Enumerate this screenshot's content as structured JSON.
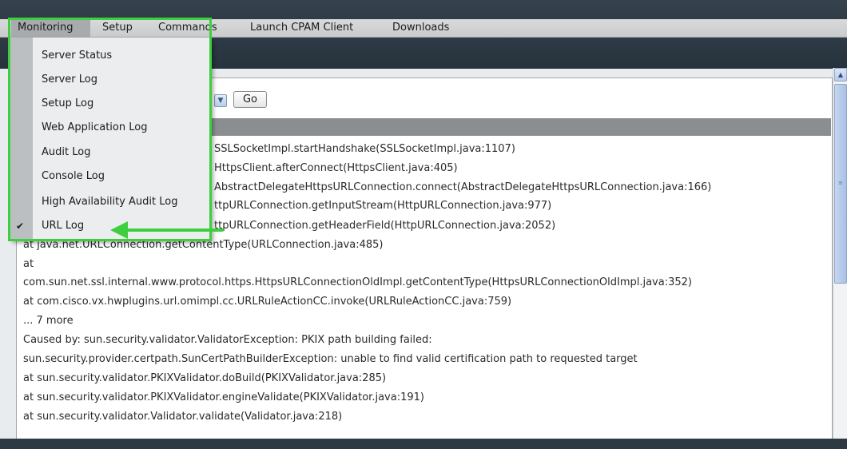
{
  "menubar": {
    "items": [
      {
        "label": "Monitoring"
      },
      {
        "label": "Setup"
      },
      {
        "label": "Commands"
      },
      {
        "label": "Launch CPAM Client"
      },
      {
        "label": "Downloads"
      }
    ]
  },
  "toolbar": {
    "go_label": "Go"
  },
  "monitoring_menu": {
    "items": [
      {
        "label": "Server Status",
        "checked": false
      },
      {
        "label": "Server Log",
        "checked": false
      },
      {
        "label": "Setup Log",
        "checked": false
      },
      {
        "label": "Web Application Log",
        "checked": false
      },
      {
        "label": "Audit Log",
        "checked": false
      },
      {
        "label": "Console Log",
        "checked": false
      },
      {
        "label": "High Availability Audit Log",
        "checked": false
      },
      {
        "label": "URL Log",
        "checked": true
      }
    ],
    "check_glyph": "✔"
  },
  "log": {
    "lines": [
      {
        "text": "SSLSocketImpl.startHandshake(SSLSocketImpl.java:1107)"
      },
      {
        "text": "HttpsClient.afterConnect(HttpsClient.java:405)"
      },
      {
        "text": "AbstractDelegateHttpsURLConnection.connect(AbstractDelegateHttpsURLConnection.java:166)"
      },
      {
        "text": "ttpURLConnection.getInputStream(HttpURLConnection.java:977)"
      },
      {
        "text": "ttpURLConnection.getHeaderField(HttpURLConnection.java:2052)"
      },
      {
        "text": "at java.net.URLConnection.getContentType(URLConnection.java:485)"
      },
      {
        "text": "at"
      },
      {
        "text": "com.sun.net.ssl.internal.www.protocol.https.HttpsURLConnectionOldImpl.getContentType(HttpsURLConnectionOldImpl.java:352)"
      },
      {
        "text": "at com.cisco.vx.hwplugins.url.omimpl.cc.URLRuleActionCC.invoke(URLRuleActionCC.java:759)"
      },
      {
        "text": "... 7 more"
      },
      {
        "text": "Caused by: sun.security.validator.ValidatorException: PKIX path building failed:"
      },
      {
        "text": "sun.security.provider.certpath.SunCertPathBuilderException: unable to find valid certification path to requested target"
      },
      {
        "text": "at sun.security.validator.PKIXValidator.doBuild(PKIXValidator.java:285)"
      },
      {
        "text": "at sun.security.validator.PKIXValidator.engineValidate(PKIXValidator.java:191)"
      },
      {
        "text": "at sun.security.validator.Validator.validate(Validator.java:218)"
      }
    ]
  },
  "colors": {
    "highlight_green": "#3ecf3e",
    "dark_band": "#2f3b45",
    "menubar": "#cfd1d2"
  },
  "icons": {
    "scroll_up": "▲",
    "select_arrow": "▼",
    "scroll_grip": "≡"
  }
}
